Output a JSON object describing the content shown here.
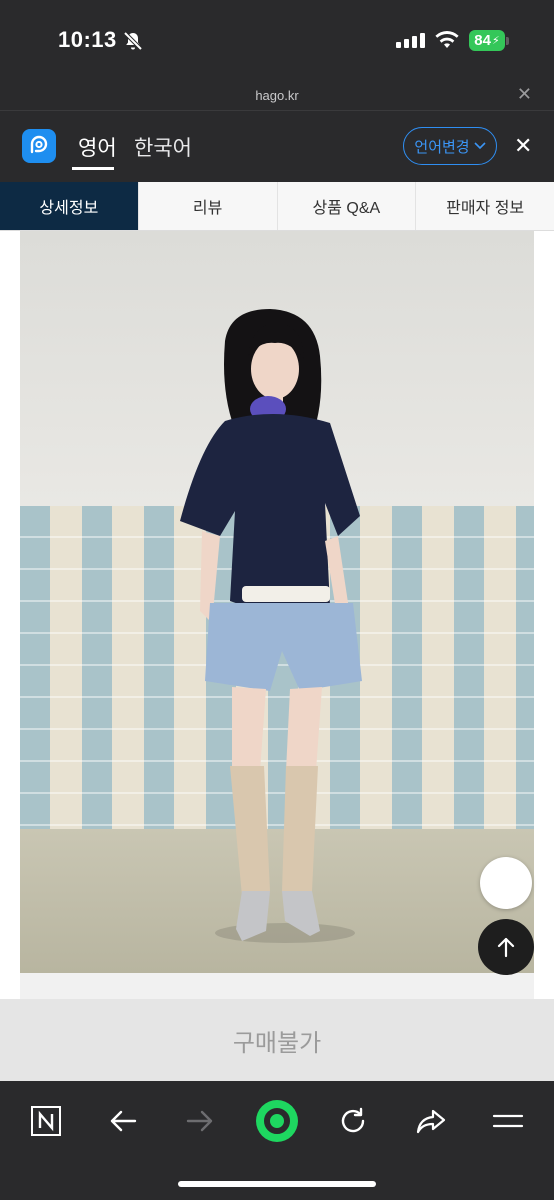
{
  "status_bar": {
    "time": "10:13",
    "battery": "84"
  },
  "browser": {
    "url": "hago.kr"
  },
  "translate_bar": {
    "languages": [
      {
        "label": "영어",
        "selected": true
      },
      {
        "label": "한국어",
        "selected": false
      }
    ],
    "change_language_label": "언어변경"
  },
  "tabs": [
    {
      "label": "상세정보",
      "active": true
    },
    {
      "label": "리뷰",
      "active": false
    },
    {
      "label": "상품 Q&A",
      "active": false
    },
    {
      "label": "판매자 정보",
      "active": false
    }
  ],
  "purchase": {
    "label": "구매불가"
  },
  "nav_icons": [
    "naver-n-icon",
    "back-arrow-icon",
    "forward-arrow-icon",
    "home-circle-icon",
    "refresh-icon",
    "share-icon",
    "menu-icon"
  ],
  "colors": {
    "accent_blue": "#2f8ef2",
    "active_tab": "#0d2a44",
    "home_green": "#1ed760",
    "battery_green": "#34c759"
  }
}
